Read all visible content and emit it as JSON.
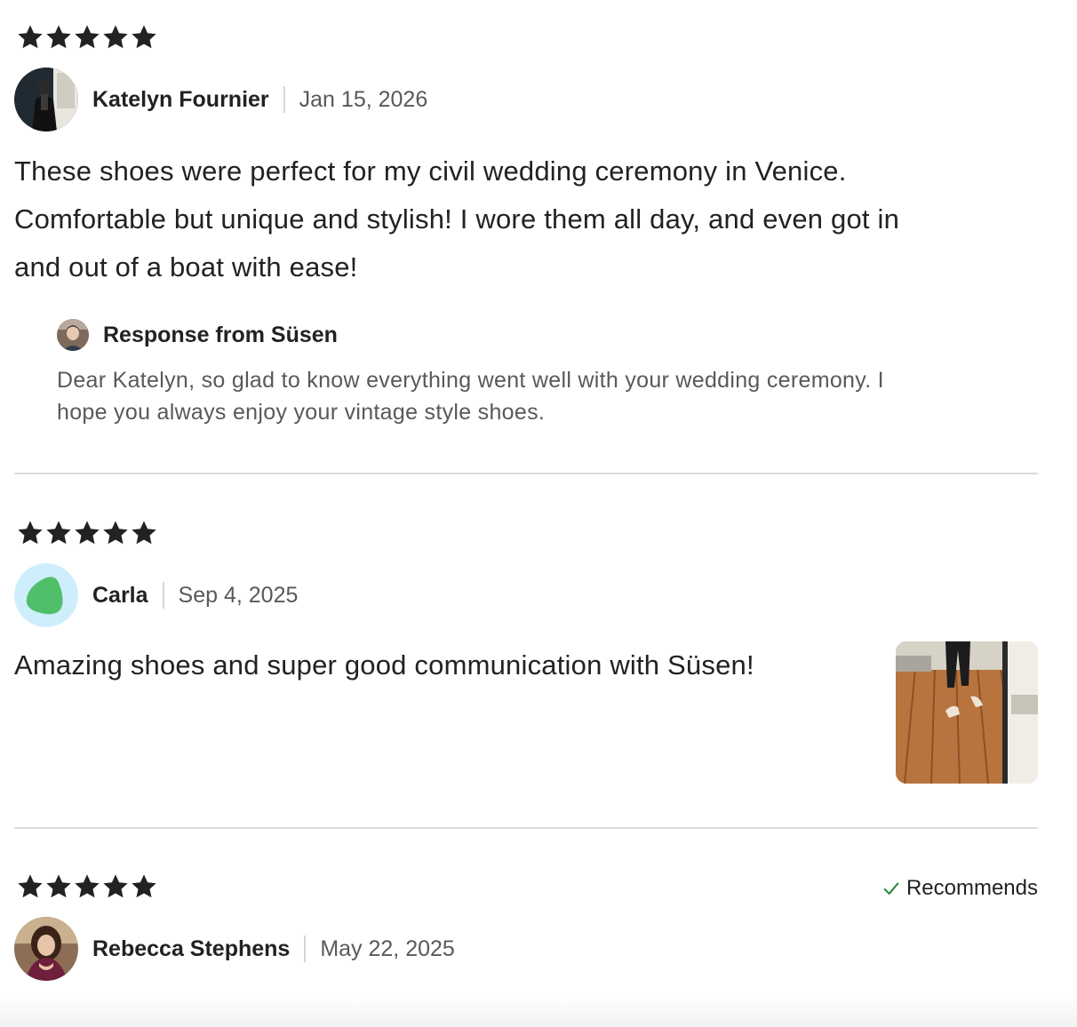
{
  "reviews": [
    {
      "rating": 5,
      "rating_icon": "star-icon",
      "reviewer_name": "Katelyn Fournier",
      "date": "Jan 15, 2026",
      "text_lines": [
        "These shoes were perfect for my civil wedding ceremony in Venice.",
        "Comfortable but unique and stylish! I wore them all day, and even got in",
        "and out of a boat with ease!"
      ],
      "response": {
        "title": "Response from Süsen",
        "text_lines": [
          "Dear Katelyn, so glad to know everything went well with your wedding ceremony. I",
          "hope you always enjoy your vintage style shoes."
        ]
      }
    },
    {
      "rating": 5,
      "rating_icon": "star-icon",
      "reviewer_name": "Carla",
      "date": "Sep 4, 2025",
      "text": "Amazing shoes and super good communication with Süsen!",
      "photo": "review-photo-shoes"
    },
    {
      "rating": 5,
      "rating_icon": "star-icon",
      "reviewer_name": "Rebecca Stephens",
      "date": "May 22, 2025",
      "recommends_label": "Recommends",
      "recommends_icon": "check-icon"
    }
  ],
  "colors": {
    "text": "#222222",
    "muted": "#595959",
    "divider": "#dcdcdc",
    "check": "#258635",
    "carla_avatar_bg": "#cfeefc",
    "carla_avatar_shape": "#4fbf6a"
  }
}
